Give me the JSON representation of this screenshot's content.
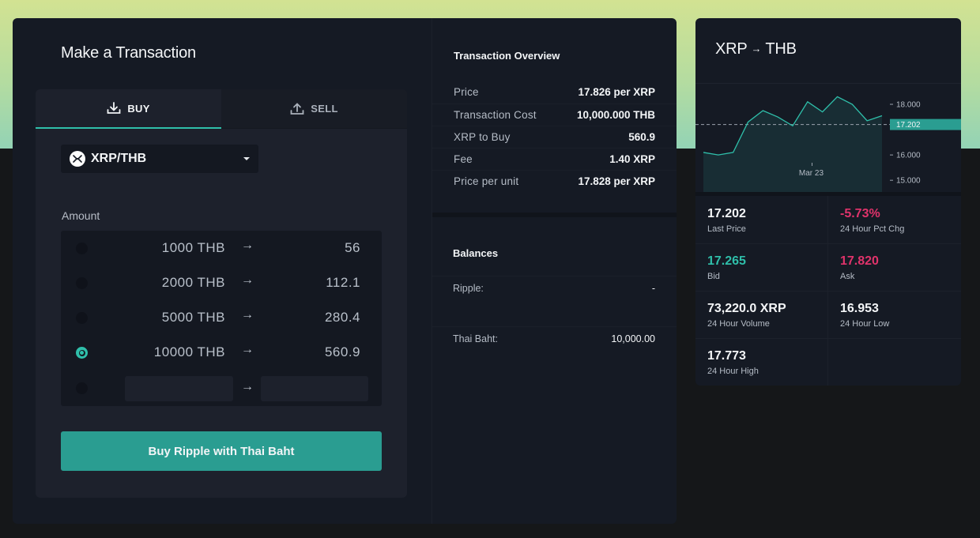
{
  "colors": {
    "accent": "#2fbfaa",
    "button": "#2a9d91",
    "negative": "#e0336b",
    "panel": "#151a24"
  },
  "transaction": {
    "title": "Make a Transaction",
    "tabs": [
      {
        "label": "BUY",
        "icon": "download-arrow-icon",
        "active": true
      },
      {
        "label": "SELL",
        "icon": "upload-arrow-icon",
        "active": false
      }
    ],
    "pair": {
      "label": "XRP/THB",
      "icon": "ripple-logo-icon"
    },
    "amount_label": "Amount",
    "rows": [
      {
        "from": "1000 THB",
        "to": "56",
        "selected": false
      },
      {
        "from": "2000 THB",
        "to": "112.1",
        "selected": false
      },
      {
        "from": "5000 THB",
        "to": "280.4",
        "selected": false
      },
      {
        "from": "10000 THB",
        "to": "560.9",
        "selected": true
      }
    ],
    "arrow": "→",
    "custom_from_value": "",
    "custom_to_value": "",
    "action_label": "Buy Ripple with Thai Baht"
  },
  "overview": {
    "title": "Transaction Overview",
    "rows": [
      {
        "key": "Price",
        "value": "17.826 per XRP"
      },
      {
        "key": "Transaction Cost",
        "value": "10,000.000 THB"
      },
      {
        "key": "XRP to Buy",
        "value": "560.9"
      },
      {
        "key": "Fee",
        "value": "1.40 XRP"
      },
      {
        "key": "Price per unit",
        "value": "17.828 per XRP"
      }
    ],
    "balances_title": "Balances",
    "balances": [
      {
        "key": "Ripple:",
        "value": "-"
      },
      {
        "key": "Thai Baht:",
        "value": "10,000.00"
      }
    ]
  },
  "market": {
    "title_base": "XRP",
    "title_arrow": "→",
    "title_quote": "THB",
    "stats": [
      {
        "value": "17.202",
        "label": "Last Price",
        "color": "#f3f5f7"
      },
      {
        "value": "-5.73%",
        "label": "24 Hour Pct Chg",
        "color": "#e0336b"
      },
      {
        "value": "17.265",
        "label": "Bid",
        "color": "#2fbfaa"
      },
      {
        "value": "17.820",
        "label": "Ask",
        "color": "#e0336b"
      },
      {
        "value": "73,220.0 XRP",
        "label": "24 Hour Volume",
        "color": "#f3f5f7"
      },
      {
        "value": "16.953",
        "label": "24 Hour Low",
        "color": "#f3f5f7"
      },
      {
        "value": "17.773",
        "label": "24 Hour High",
        "color": "#f3f5f7"
      }
    ]
  },
  "chart_data": {
    "type": "line",
    "x_tick_label": "Mar 23",
    "y_ticks": [
      "18.000",
      "16.000",
      "15.000"
    ],
    "current_price_label": "17.202",
    "current_price": 17.202,
    "ylim": [
      14.6,
      18.5
    ],
    "values": [
      16.1,
      16.0,
      16.1,
      17.3,
      17.75,
      17.5,
      17.15,
      18.1,
      17.7,
      18.3,
      18.0,
      17.35,
      17.55
    ]
  }
}
